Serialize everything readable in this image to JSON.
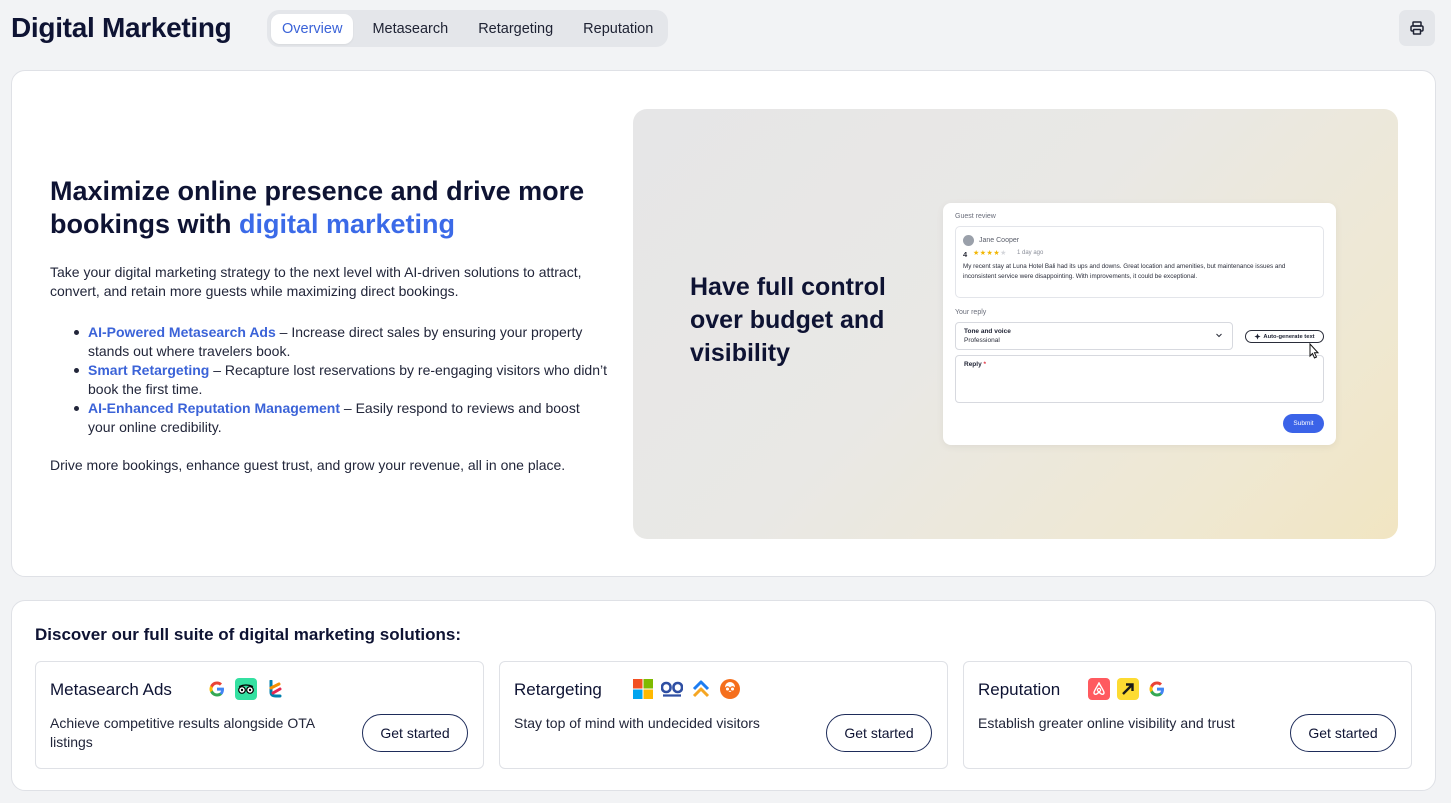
{
  "header": {
    "title": "Digital Marketing",
    "tabs": [
      {
        "label": "Overview",
        "active": true
      },
      {
        "label": "Metasearch",
        "active": false
      },
      {
        "label": "Retargeting",
        "active": false
      },
      {
        "label": "Reputation",
        "active": false
      }
    ],
    "print_icon": "printer-icon"
  },
  "hero": {
    "heading_part1": "Maximize online presence and drive more bookings with ",
    "heading_accent": "digital marketing",
    "intro": "Take your digital marketing strategy to the next level with AI-driven solutions to attract, convert, and retain more guests while maximizing direct bookings.",
    "bullets": [
      {
        "link": "AI-Powered Metasearch Ads",
        "text": " – Increase direct sales by ensuring your property stands out where travelers book."
      },
      {
        "link": "Smart Retargeting",
        "text": " – Recapture lost reservations by re-engaging visitors who didn’t book the first time."
      },
      {
        "link": "AI-Enhanced Reputation Management",
        "text": " – Easily respond to reviews and boost your online credibility."
      }
    ],
    "outro": "Drive more bookings, enhance guest trust, and grow your revenue, all in one place.",
    "promo_text": "Have full control over budget and visibility",
    "review_mock": {
      "section_label": "Guest review",
      "reviewer": "Jane Cooper",
      "rating": "4",
      "stars_filled": 4,
      "stars_total": 5,
      "time": "1 day ago",
      "body": "My recent stay at Luna Hotel Bali had its ups and downs. Great location and amenities, but maintenance issues and inconsistent service were disappointing. With improvements, it could be exceptional.",
      "reply_label": "Your reply",
      "tone_label": "Tone and voice",
      "tone_value": "Professional",
      "auto_button": "Auto-generate text",
      "reply_field_label": "Reply",
      "required_mark": "*",
      "submit": "Submit"
    }
  },
  "suite": {
    "title": "Discover our full suite of digital marketing solutions:",
    "solutions": [
      {
        "name": "Metasearch Ads",
        "desc": "Achieve competitive results alongside OTA listings",
        "button": "Get started",
        "icons": [
          "google-icon",
          "tripadvisor-icon",
          "trivago-icon"
        ]
      },
      {
        "name": "Retargeting",
        "desc": "Stay top of mind with undecided visitors",
        "button": "Get started",
        "icons": [
          "microsoft-icon",
          "meta-icon",
          "adroll-icon",
          "criteo-icon"
        ]
      },
      {
        "name": "Reputation",
        "desc": "Establish greater online visibility and trust",
        "button": "Get started",
        "icons": [
          "airbnb-icon",
          "expedia-icon",
          "google-icon"
        ]
      }
    ]
  },
  "colors": {
    "accent": "#3b6ae8",
    "title": "#0e1333",
    "submit": "#3b63e8"
  }
}
